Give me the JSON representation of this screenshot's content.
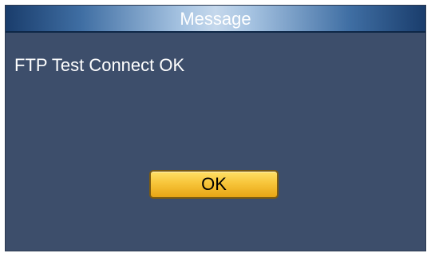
{
  "dialog": {
    "title": "Message",
    "message": "FTP Test Connect OK",
    "ok_label": "OK"
  },
  "colors": {
    "panel_background": "#3d4e6b",
    "titlebar_highlight": "#c5d8ec",
    "button_gold": "#f7c53a",
    "text": "#ffffff"
  }
}
